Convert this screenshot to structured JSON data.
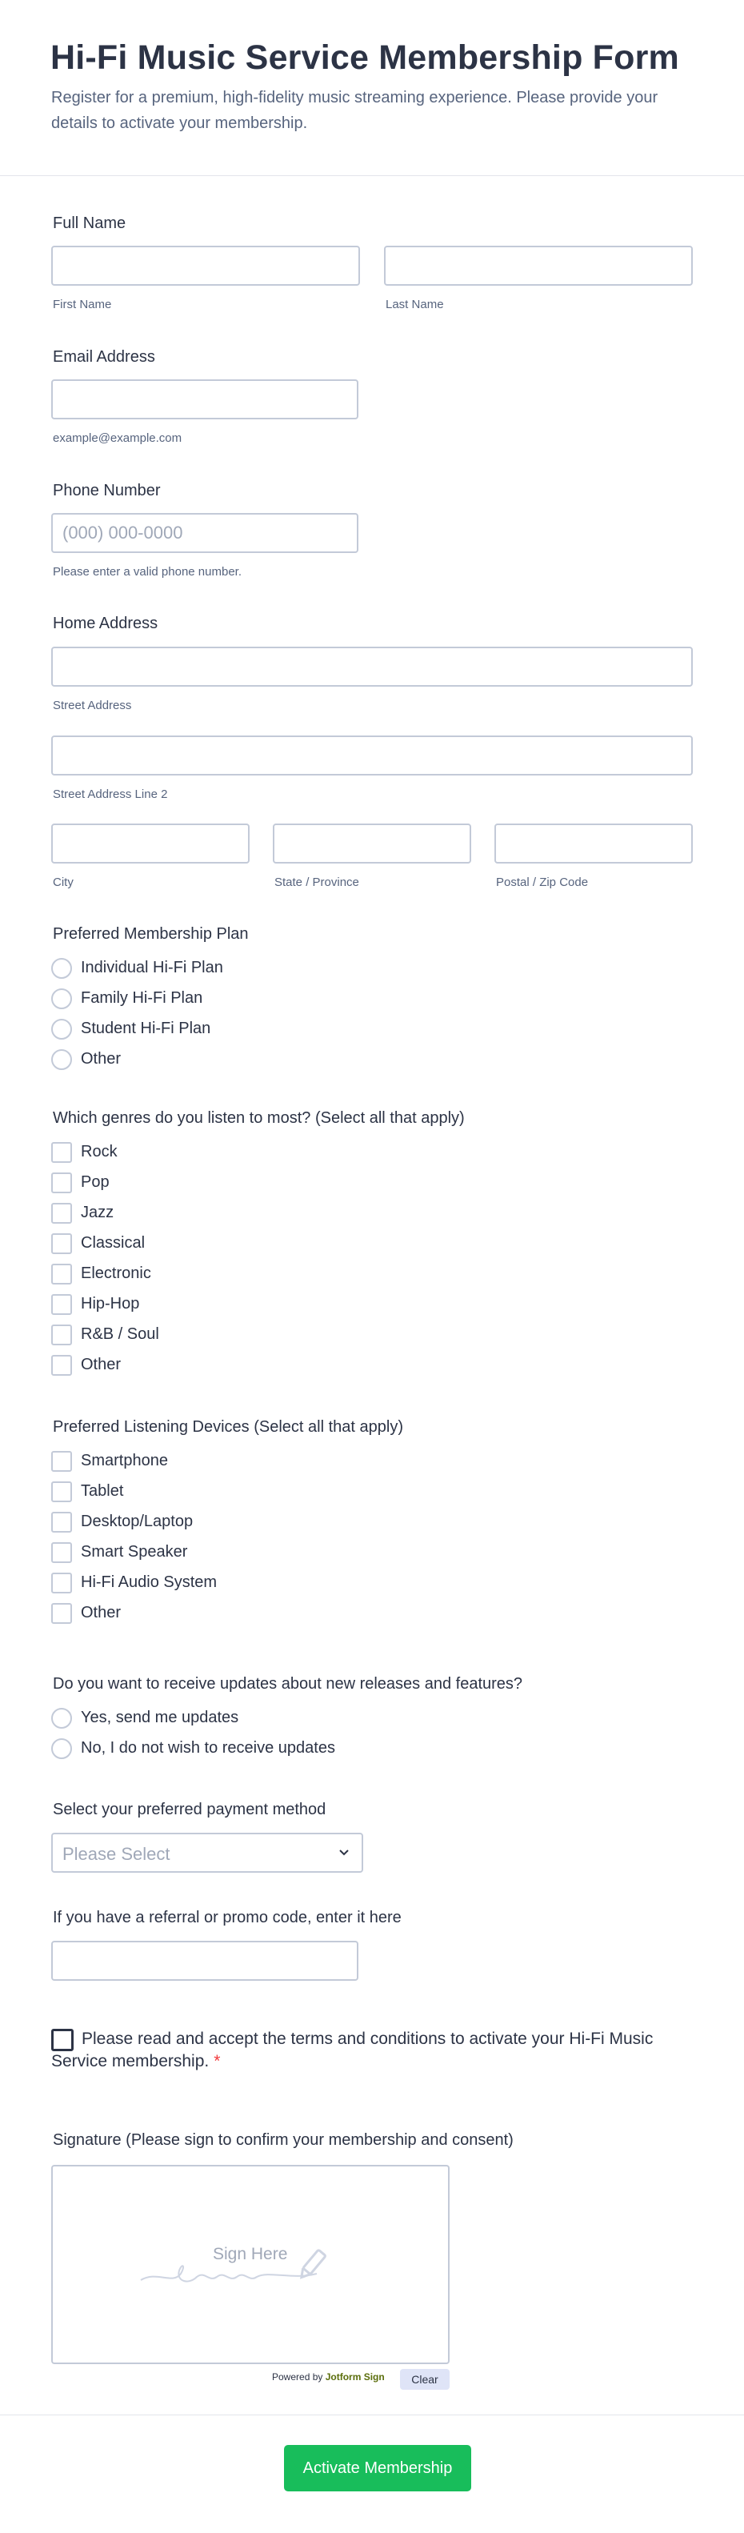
{
  "header": {
    "title": "Hi-Fi Music Service Membership Form",
    "subtitle": "Register for a premium, high-fidelity music streaming experience. Please provide your details to activate your membership."
  },
  "full_name": {
    "label": "Full Name",
    "first_sub": "First Name",
    "last_sub": "Last Name"
  },
  "email": {
    "label": "Email Address",
    "sub": "example@example.com"
  },
  "phone": {
    "label": "Phone Number",
    "placeholder": "(000) 000-0000",
    "sub": "Please enter a valid phone number."
  },
  "address": {
    "label": "Home Address",
    "street_sub": "Street Address",
    "street2_sub": "Street Address Line 2",
    "city_sub": "City",
    "state_sub": "State / Province",
    "zip_sub": "Postal / Zip Code"
  },
  "plan": {
    "label": "Preferred Membership Plan",
    "options": [
      "Individual Hi-Fi Plan",
      "Family Hi-Fi Plan",
      "Student Hi-Fi Plan",
      "Other"
    ]
  },
  "genres": {
    "label": "Which genres do you listen to most? (Select all that apply)",
    "options": [
      "Rock",
      "Pop",
      "Jazz",
      "Classical",
      "Electronic",
      "Hip-Hop",
      "R&B / Soul",
      "Other"
    ]
  },
  "devices": {
    "label": "Preferred Listening Devices (Select all that apply)",
    "options": [
      "Smartphone",
      "Tablet",
      "Desktop/Laptop",
      "Smart Speaker",
      "Hi-Fi Audio System",
      "Other"
    ]
  },
  "updates": {
    "label": "Do you want to receive updates about new releases and features?",
    "options": [
      "Yes, send me updates",
      "No, I do not wish to receive updates"
    ]
  },
  "payment": {
    "label": "Select your preferred payment method",
    "selected": "Please Select"
  },
  "promo": {
    "label": "If you have a referral or promo code, enter it here"
  },
  "terms": {
    "text": "Please read and accept the terms and conditions to activate your Hi-Fi Music Service membership.",
    "required_mark": "*"
  },
  "signature": {
    "label": "Signature (Please sign to confirm your membership and consent)",
    "hint": "Sign Here",
    "powered_prefix": "Powered by",
    "powered_brand": "Jotform Sign",
    "clear_label": "Clear"
  },
  "submit": {
    "label": "Activate Membership"
  },
  "colors": {
    "accent": "#18bd5b",
    "border": "#c3cad8",
    "text": "#2c3345",
    "muted": "#57647e",
    "required": "#f23a3c"
  }
}
